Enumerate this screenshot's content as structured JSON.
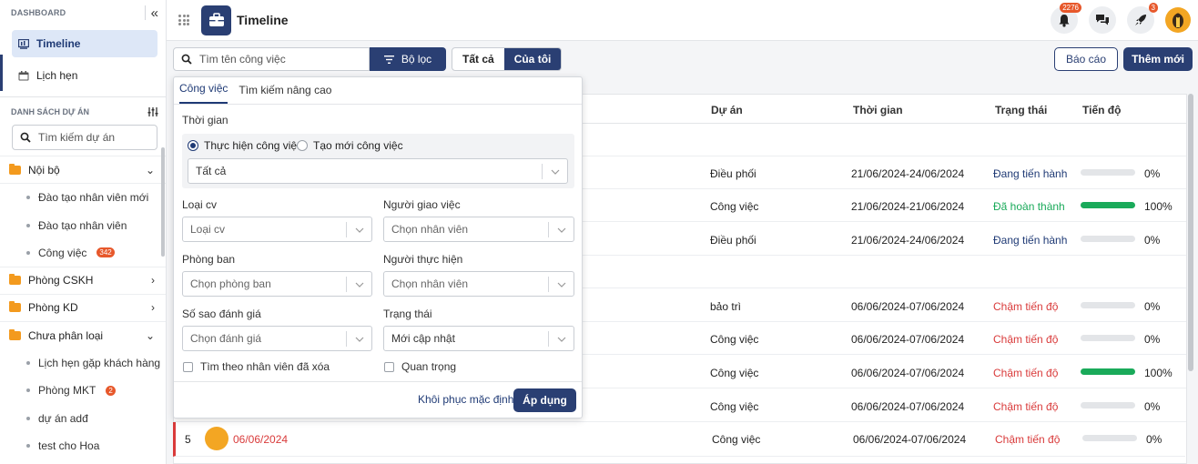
{
  "sidebar": {
    "dashboard_label": "DASHBOARD",
    "nav": [
      {
        "label": "Timeline",
        "icon": "timeline-icon",
        "active": true
      },
      {
        "label": "Lịch hẹn",
        "icon": "calendar-icon",
        "active": false
      }
    ],
    "projects_title": "DANH SÁCH DỰ ÁN",
    "search_placeholder": "Tìm kiếm dự án",
    "groups": [
      {
        "label": "Nội bộ",
        "expanded": true,
        "children": [
          {
            "label": "Đào tạo nhân viên mới"
          },
          {
            "label": "Đào tạo nhân viên"
          },
          {
            "label": "Công việc",
            "badge": "342"
          }
        ]
      },
      {
        "label": "Phòng CSKH",
        "expanded": false
      },
      {
        "label": "Phòng KD",
        "expanded": false
      },
      {
        "label": "Chưa phân loại",
        "expanded": true,
        "children": [
          {
            "label": "Lịch hẹn gặp khách hàng"
          },
          {
            "label": "Phòng MKT",
            "badge": "2"
          },
          {
            "label": "dự án adđ"
          },
          {
            "label": "test cho Hoa"
          }
        ]
      }
    ]
  },
  "header": {
    "title": "Timeline",
    "notifications_badge": "2276",
    "rocket_badge": "3"
  },
  "toolbar": {
    "search_placeholder": "Tìm tên công việc",
    "filter_label": "Bộ lọc",
    "seg_all": "Tất cả",
    "seg_mine": "Của tôi",
    "report_label": "Báo cáo",
    "add_label": "Thêm mới"
  },
  "table": {
    "columns": {
      "project": "Dự án",
      "time": "Thời gian",
      "status": "Trạng thái",
      "progress": "Tiến độ"
    },
    "rows": [
      {
        "project": "Điều phối",
        "time": "21/06/2024-24/06/2024",
        "status": "Đang tiến hành",
        "status_type": "blue",
        "progress": 0,
        "progress_label": "0%"
      },
      {
        "project": "Công việc",
        "time": "21/06/2024-21/06/2024",
        "status": "Đã hoàn thành",
        "status_type": "green",
        "progress": 100,
        "progress_label": "100%"
      },
      {
        "project": "Điều phối",
        "time": "21/06/2024-24/06/2024",
        "status": "Đang tiến hành",
        "status_type": "blue",
        "progress": 0,
        "progress_label": "0%"
      },
      {
        "project": "bảo trì",
        "time": "06/06/2024-07/06/2024",
        "status": "Chậm tiến độ",
        "status_type": "red",
        "progress": 0,
        "progress_label": "0%"
      },
      {
        "project": "Công việc",
        "time": "06/06/2024-07/06/2024",
        "status": "Chậm tiến độ",
        "status_type": "red",
        "progress": 0,
        "progress_label": "0%"
      },
      {
        "project": "Công việc",
        "time": "06/06/2024-07/06/2024",
        "status": "Chậm tiến độ",
        "status_type": "red",
        "progress": 100,
        "progress_label": "100%"
      },
      {
        "project": "Công việc",
        "time": "06/06/2024-07/06/2024",
        "status": "Chậm tiến độ",
        "status_type": "red",
        "progress": 0,
        "progress_label": "0%"
      },
      {
        "index": "5",
        "date": "06/06/2024",
        "project": "Công việc",
        "time": "06/06/2024-07/06/2024",
        "status": "Chậm tiến độ",
        "status_type": "red",
        "progress": 0,
        "progress_label": "0%"
      }
    ]
  },
  "filter_panel": {
    "tab_tasks": "Công việc",
    "tab_advanced": "Tìm kiếm nâng cao",
    "time_label": "Thời gian",
    "radio_exec": "Thực hiện công việc",
    "radio_new": "Tạo mới công việc",
    "time_value": "Tất cả",
    "type_label": "Loại cv",
    "type_placeholder": "Loại cv",
    "assigner_label": "Người giao việc",
    "assigner_placeholder": "Chọn nhân viên",
    "dept_label": "Phòng ban",
    "dept_placeholder": "Chọn phòng ban",
    "executor_label": "Người thực hiện",
    "executor_placeholder": "Chọn nhân viên",
    "rating_label": "Số sao đánh giá",
    "rating_placeholder": "Chọn đánh giá",
    "status_label": "Trạng thái",
    "status_value": "Mới cập nhật",
    "chk_deleted": "Tìm theo nhân viên đã xóa",
    "chk_important": "Quan trọng",
    "reset_label": "Khôi phục mặc định",
    "apply_label": "Áp dụng"
  },
  "colors": {
    "primary": "#2a3f73",
    "accent": "#e7582b",
    "success": "#1aaa5a",
    "danger": "#d93a3a"
  }
}
